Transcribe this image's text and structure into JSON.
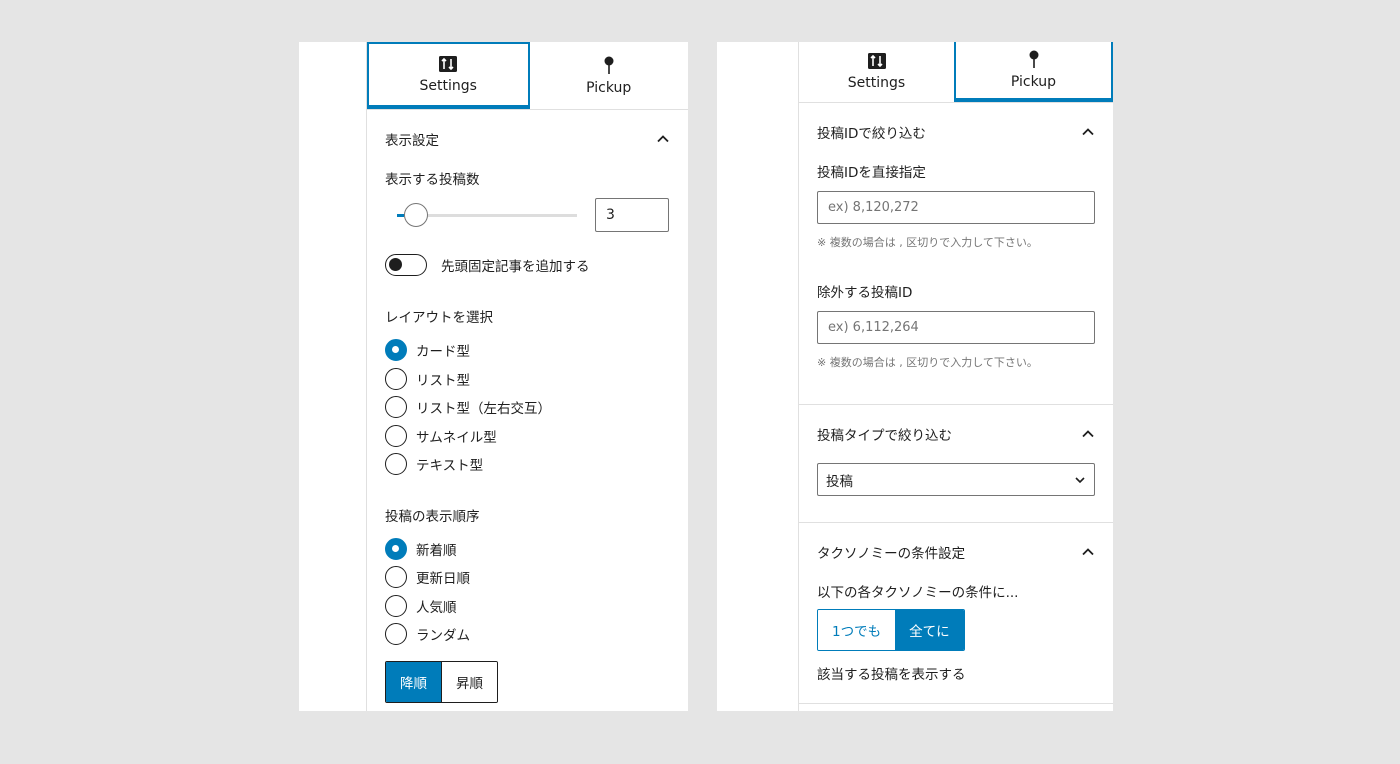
{
  "left": {
    "tabs": [
      {
        "label": "Settings",
        "icon": "settings-sliders-icon",
        "active": true
      },
      {
        "label": "Pickup",
        "icon": "pin-icon",
        "active": false
      }
    ],
    "display_settings": {
      "title": "表示設定",
      "post_count_label": "表示する投稿数",
      "post_count_value": "3",
      "post_count_slider_min": 1,
      "post_count_slider_max": 50,
      "post_count_slider_value": 3,
      "sticky_toggle_label": "先頭固定記事を追加する",
      "sticky_toggle_on": false,
      "layout_label": "レイアウトを選択",
      "layouts": [
        {
          "label": "カード型",
          "checked": true
        },
        {
          "label": "リスト型",
          "checked": false
        },
        {
          "label": "リスト型（左右交互）",
          "checked": false
        },
        {
          "label": "サムネイル型",
          "checked": false
        },
        {
          "label": "テキスト型",
          "checked": false
        }
      ],
      "order_label": "投稿の表示順序",
      "orders": [
        {
          "label": "新着順",
          "checked": true
        },
        {
          "label": "更新日順",
          "checked": false
        },
        {
          "label": "人気順",
          "checked": false
        },
        {
          "label": "ランダム",
          "checked": false
        }
      ],
      "sort_desc": "降順",
      "sort_asc": "昇順"
    }
  },
  "right": {
    "tabs": [
      {
        "label": "Settings",
        "icon": "settings-sliders-icon",
        "active": false
      },
      {
        "label": "Pickup",
        "icon": "pin-icon",
        "active": true
      }
    ],
    "id_filter": {
      "title": "投稿IDで絞り込む",
      "include_label": "投稿IDを直接指定",
      "include_placeholder": "ex) 8,120,272",
      "include_hint": "※ 複数の場合は , 区切りで入力して下さい。",
      "exclude_label": "除外する投稿ID",
      "exclude_placeholder": "ex) 6,112,264",
      "exclude_hint": "※ 複数の場合は , 区切りで入力して下さい。"
    },
    "type_filter": {
      "title": "投稿タイプで絞り込む",
      "selected": "投稿"
    },
    "taxonomy": {
      "title": "タクソノミーの条件設定",
      "condition_label": "以下の各タクソノミーの条件に...",
      "any": "1つでも",
      "all": "全てに",
      "footer": "該当する投稿を表示する"
    }
  },
  "colors": {
    "accent": "#007cba",
    "border": "#e0e0e0",
    "muted": "#757575"
  }
}
